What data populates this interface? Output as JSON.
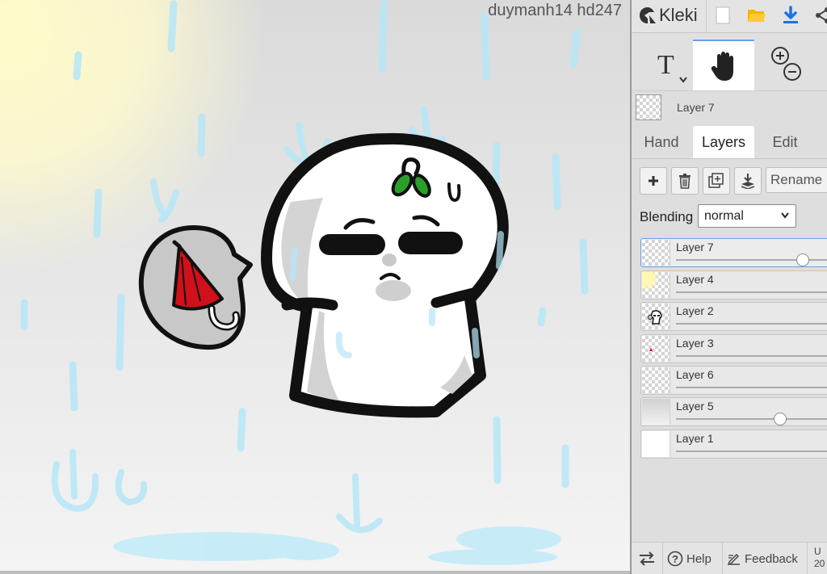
{
  "watermark": "duymanh14 hd247",
  "app": {
    "logo_text": "Kleki"
  },
  "toolbar": {
    "icons": [
      "new-image-icon",
      "open-folder-icon",
      "download-icon",
      "share-icon"
    ],
    "tools": [
      {
        "name": "text-tool",
        "glyph": "T"
      },
      {
        "name": "hand-tool",
        "active": true
      },
      {
        "name": "zoom-tool"
      }
    ]
  },
  "current_layer": {
    "label": "Layer 7"
  },
  "tabs": [
    {
      "label": "Hand",
      "active": false
    },
    {
      "label": "Layers",
      "active": true
    },
    {
      "label": "Edit",
      "active": false
    }
  ],
  "layer_actions": {
    "rename_label": "Rename"
  },
  "blending": {
    "label": "Blending",
    "value": "normal"
  },
  "layers": [
    {
      "name": "Layer 7",
      "selected": true,
      "opacity": 0.7
    },
    {
      "name": "Layer 4",
      "selected": false,
      "opacity": 1
    },
    {
      "name": "Layer 2",
      "selected": false,
      "opacity": 1
    },
    {
      "name": "Layer 3",
      "selected": false,
      "opacity": 1
    },
    {
      "name": "Layer 6",
      "selected": false,
      "opacity": 1
    },
    {
      "name": "Layer 5",
      "selected": false,
      "opacity": 0.6
    },
    {
      "name": "Layer 1",
      "selected": false,
      "opacity": 1
    }
  ],
  "footer": {
    "help_label": "Help",
    "feedback_label": "Feedback",
    "partial_text_top": "U",
    "partial_text_bottom": "20"
  },
  "colors": {
    "accent": "#1a73e8",
    "folder": "#f5b400",
    "rain": "#aee3f5",
    "umbrella": "#d0101a",
    "leaf": "#2aa02a"
  }
}
